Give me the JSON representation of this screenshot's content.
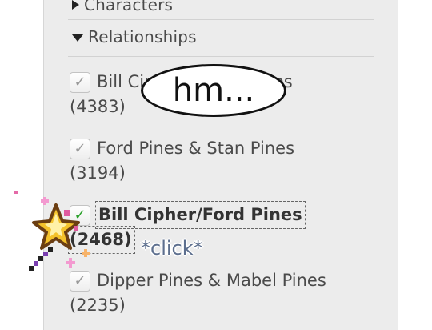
{
  "sidebar": {
    "sections": [
      {
        "label": "Characters",
        "expanded": false
      },
      {
        "label": "Relationships",
        "expanded": true
      }
    ],
    "items": [
      {
        "label": "Bill Cipher & Ford Pines",
        "count": "(4383)",
        "checked": false
      },
      {
        "label": "Ford Pines & Stan Pines",
        "count": "(3194)",
        "checked": false
      },
      {
        "label": "Bill Cipher/Ford Pines",
        "count": "(2468)",
        "checked": true
      },
      {
        "label": "Dipper Pines & Mabel Pines",
        "count": "(2235)",
        "checked": false
      }
    ]
  },
  "overlay": {
    "thought_bubble": "hm...",
    "click_text": "*click*"
  },
  "icons": {
    "expand_arrow": "triangle-right",
    "collapse_arrow": "triangle-down",
    "check": "✓",
    "wand": "star-magic-wand"
  }
}
